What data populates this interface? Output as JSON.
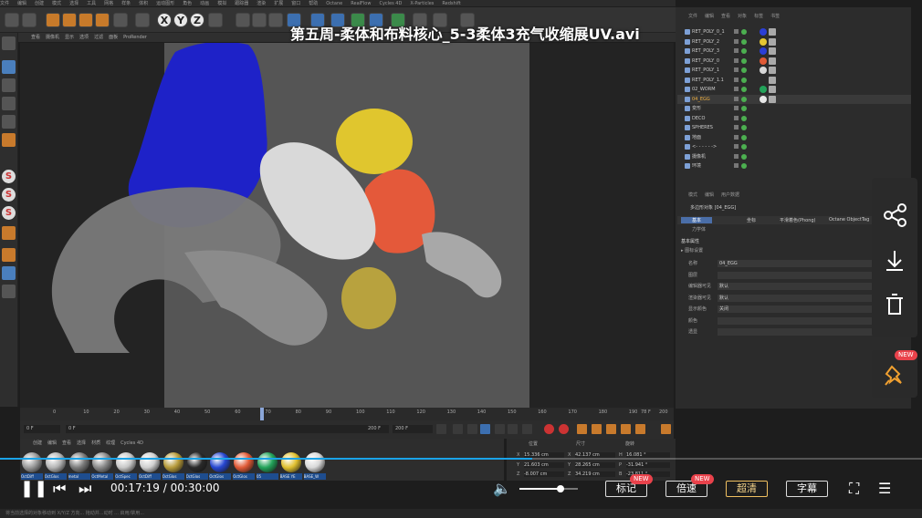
{
  "video": {
    "title": "第五周-柔体和布料核心_5-3柔体3充气收缩展UV.avi",
    "current_time": "00:17:19",
    "separator": "/",
    "total_time": "00:30:00",
    "progress": 0.577,
    "volume": 0.7,
    "buttons": {
      "mark": "标记",
      "speed": "倍速",
      "quality": "超清",
      "subtitle": "字幕"
    },
    "new_badge": "NEW"
  },
  "c4d": {
    "menu": [
      "文件",
      "编辑",
      "创建",
      "模式",
      "选择",
      "工具",
      "网格",
      "样条",
      "体积",
      "运动图形",
      "角色",
      "动画",
      "模拟",
      "跟踪器",
      "渲染",
      "扩展",
      "窗口",
      "帮助",
      "Octane",
      "RealFlow",
      "Cycles 4D",
      "X-Particles",
      "Redshift"
    ],
    "viewport_menu": [
      "查看",
      "摄像机",
      "显示",
      "选项",
      "过滤",
      "面板",
      "ProRender"
    ],
    "object_manager": {
      "menu": [
        "文件",
        "编辑",
        "查看",
        "对象",
        "标签",
        "书签"
      ],
      "objects": [
        {
          "name": "RET_POLY_0_1",
          "mat": "#2b3fd6"
        },
        {
          "name": "RET_POLY_2",
          "mat": "#e5c733"
        },
        {
          "name": "RET_POLY_3",
          "mat": "#2b3fd6"
        },
        {
          "name": "RET_POLY_0",
          "mat": "#e05a36"
        },
        {
          "name": "RET_POLY_1",
          "mat": "#d8d8d8"
        },
        {
          "name": "RET_POLY_1.1",
          "mat": "#2c2c2c"
        },
        {
          "name": "02_WORM",
          "mat": "#23a35a"
        },
        {
          "name": "04_EGG",
          "mat": "#e8e8e8"
        },
        {
          "name": "变形",
          "mat": ""
        },
        {
          "name": "DECO",
          "mat": ""
        },
        {
          "name": "SPHERES",
          "mat": ""
        },
        {
          "name": "地面",
          "mat": ""
        },
        {
          "name": "<- - - - - ->",
          "mat": ""
        },
        {
          "name": "摄像机",
          "mat": ""
        },
        {
          "name": "环境",
          "mat": ""
        }
      ]
    },
    "attributes": {
      "tabs": [
        "模式",
        "编辑",
        "用户数据"
      ],
      "object": "多边形对象 [04_EGG]",
      "modes": [
        "基本",
        "坐标",
        "平滑着色(Phong)",
        "Octane ObjectTag"
      ],
      "submode": "力学体",
      "section": "基本属性",
      "subsection": "▸ 图标设置",
      "rows": [
        {
          "label": "名称",
          "value": "04_EGG"
        },
        {
          "label": "图层",
          "value": ""
        },
        {
          "label": "编辑器可见",
          "value": "默认"
        },
        {
          "label": "渲染器可见",
          "value": "默认"
        },
        {
          "label": "显示颜色",
          "value": "关闭"
        },
        {
          "label": "颜色",
          "value": ""
        },
        {
          "label": "透显",
          "value": ""
        }
      ]
    },
    "timeline": {
      "ticks": [
        "0",
        "10",
        "20",
        "30",
        "40",
        "50",
        "60",
        "70",
        "80",
        "90",
        "100",
        "110",
        "120",
        "130",
        "140",
        "150",
        "160",
        "170",
        "180",
        "190",
        "200"
      ],
      "frame_end": "78 F",
      "start": "0 F",
      "current": "0 F",
      "end_a": "200 F",
      "end_b": "200 F"
    },
    "materials": {
      "tabs": [
        "创建",
        "编辑",
        "查看",
        "选择",
        "材质",
        "纹理",
        "Cycles 4D"
      ],
      "items": [
        {
          "label": "OctDiff",
          "color": "#9a9a9a"
        },
        {
          "label": "OctGlos",
          "color": "#b5b5b5"
        },
        {
          "label": "metal",
          "color": "#7c7c7c"
        },
        {
          "label": "OctMetal",
          "color": "#8a8a8a"
        },
        {
          "label": "OctSpec",
          "color": "#c8c8c8"
        },
        {
          "label": "OctDiff",
          "color": "#d0d0d0"
        },
        {
          "label": "OctGlos",
          "color": "#b69a3a"
        },
        {
          "label": "OctGlos",
          "color": "#2a2a2a"
        },
        {
          "label": "OctGlos",
          "color": "#2747d1"
        },
        {
          "label": "OctGlos",
          "color": "#e05a36"
        },
        {
          "label": "05",
          "color": "#23a35a"
        },
        {
          "label": "BASE YE",
          "color": "#e0c030"
        },
        {
          "label": "BASE_W",
          "color": "#d8d8d8"
        }
      ]
    },
    "coords": {
      "headers": [
        "位置",
        "尺寸",
        "旋转"
      ],
      "rows": [
        {
          "axis": "X",
          "pos": "15.336 cm",
          "size": "42.137 cm",
          "rot_axis": "H",
          "rot": "16.081 °"
        },
        {
          "axis": "Y",
          "pos": "21.603 cm",
          "size": "28.265 cm",
          "rot_axis": "P",
          "rot": "-31.941 °"
        },
        {
          "axis": "Z",
          "pos": "-8.007 cm",
          "size": "34.219 cm",
          "rot_axis": "B",
          "rot": "-23.811 °"
        }
      ]
    },
    "status": "将当前选择的对象移动到 X/Y/Z 方向... 拖动并...动时 ... 启用/禁用..."
  }
}
